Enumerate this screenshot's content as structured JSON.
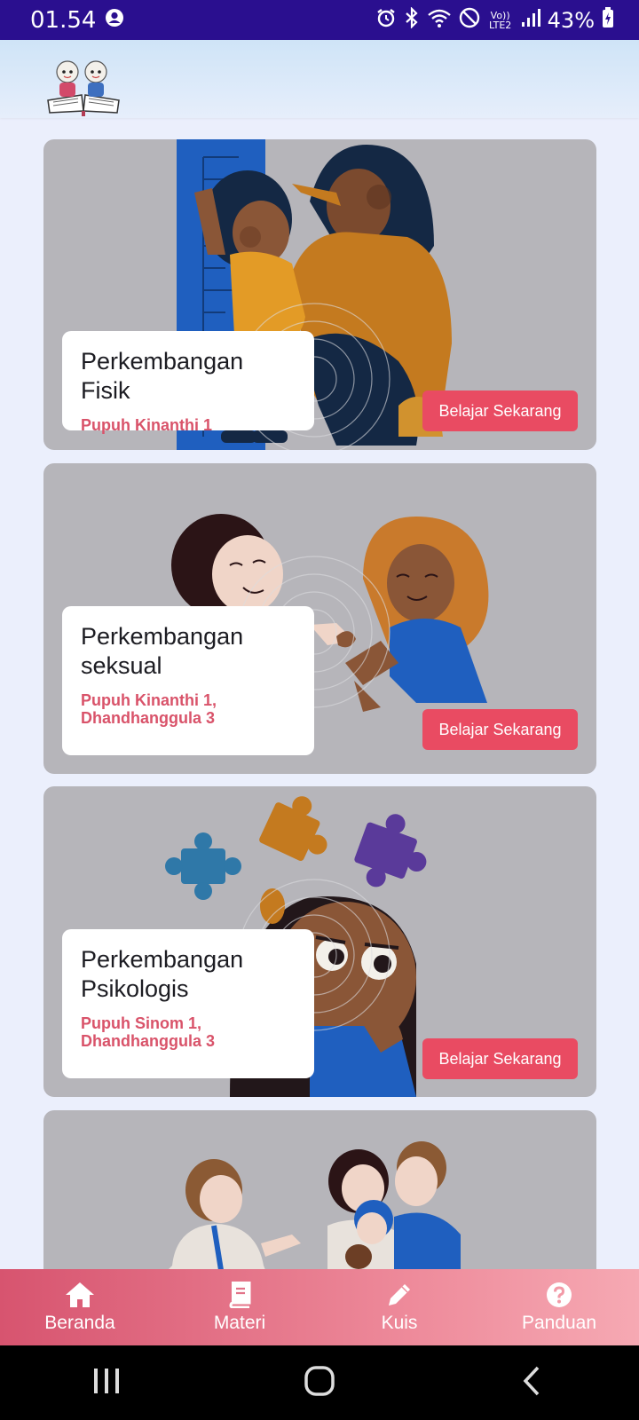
{
  "status_bar": {
    "time": "01.54",
    "battery": "43%",
    "icons": [
      "account-circle-icon",
      "alarm-icon",
      "bluetooth-icon",
      "wifi-icon",
      "do-not-disturb-icon",
      "volte-icon",
      "signal-icon",
      "battery-charging-icon"
    ],
    "network_badge": "Vo)) LTE2"
  },
  "app_bar": {
    "logo": "app-logo-children-reading-book"
  },
  "cards": [
    {
      "title": "Perkembangan Fisik",
      "subtitle": "Pupuh Kinanthi 1",
      "button": "Belajar Sekarang",
      "illustration": "mother-measuring-child-height"
    },
    {
      "title": "Perkembangan seksual",
      "subtitle": "Pupuh Kinanthi 1, Dhandhanggula 3",
      "button": "Belajar Sekarang",
      "illustration": "two-children-pinky-promise"
    },
    {
      "title": "Perkembangan Psikologis",
      "subtitle": "Pupuh Sinom 1, Dhandhanggula 3",
      "button": "Belajar Sekarang",
      "illustration": "child-thinking-with-puzzle-pieces"
    },
    {
      "illustration": "doctor-with-family"
    }
  ],
  "bottom_nav": [
    {
      "label": "Beranda",
      "icon": "home-icon"
    },
    {
      "label": "Materi",
      "icon": "book-icon"
    },
    {
      "label": "Kuis",
      "icon": "pencil-icon"
    },
    {
      "label": "Panduan",
      "icon": "help-circle-icon"
    }
  ],
  "system_nav": [
    "recent-apps-icon",
    "home-circle-icon",
    "back-icon"
  ],
  "colors": {
    "status_bar": "#2a0f8f",
    "background": "#ebeffc",
    "card": "#b6b5ba",
    "accent_button": "#e94b62",
    "subtitle": "#d9536a",
    "nav_gradient_start": "#d7546f",
    "nav_gradient_end": "#f6a9b3"
  }
}
